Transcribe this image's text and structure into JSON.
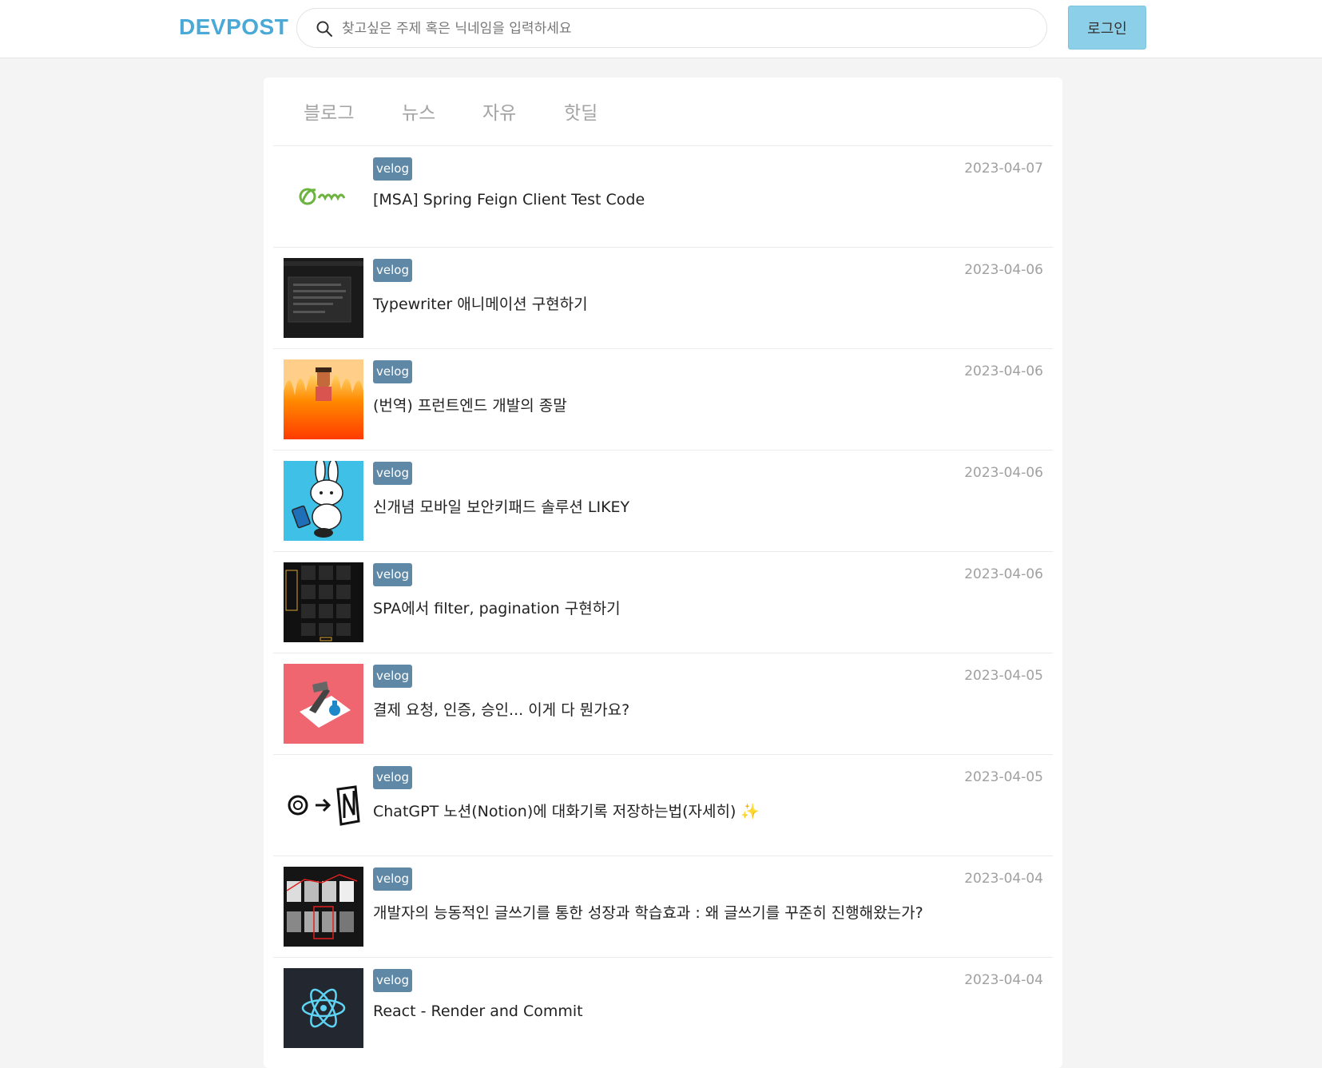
{
  "header": {
    "logo": "DEVPOST",
    "search_placeholder": "찾고싶은 주제 혹은 닉네임을 입력하세요",
    "login_label": "로그인"
  },
  "tabs": [
    {
      "label": "블로그"
    },
    {
      "label": "뉴스"
    },
    {
      "label": "자유"
    },
    {
      "label": "핫딜"
    }
  ],
  "posts": [
    {
      "source": "velog",
      "title": "[MSA] Spring Feign Client Test Code",
      "date": "2023-04-07",
      "thumb": "spring-logo"
    },
    {
      "source": "velog",
      "title": "Typewriter 애니메이션 구현하기",
      "date": "2023-04-06",
      "thumb": "dark-screenshot"
    },
    {
      "source": "velog",
      "title": "(번역) 프런트엔드 개발의 종말",
      "date": "2023-04-06",
      "thumb": "fire-image"
    },
    {
      "source": "velog",
      "title": "신개념 모바일 보안키패드 솔루션 LIKEY",
      "date": "2023-04-06",
      "thumb": "rabbit-illustration"
    },
    {
      "source": "velog",
      "title": "SPA에서 filter, pagination 구현하기",
      "date": "2023-04-06",
      "thumb": "grid-screenshot"
    },
    {
      "source": "velog",
      "title": "결제 요청, 인증, 승인... 이게 다 뭔가요?",
      "date": "2023-04-05",
      "thumb": "payment-illustration"
    },
    {
      "source": "velog",
      "title": "ChatGPT 노션(Notion)에 대화기록 저장하는법(자세히) ✨",
      "date": "2023-04-05",
      "thumb": "chatgpt-notion-logo"
    },
    {
      "source": "velog",
      "title": "개발자의 능동적인 글쓰기를 통한 성장과 학습효과 : 왜 글쓰기를 꾸준히 진행해왔는가?",
      "date": "2023-04-04",
      "thumb": "chart-screenshot"
    },
    {
      "source": "velog",
      "title": "React - Render and Commit",
      "date": "2023-04-04",
      "thumb": "react-logo"
    }
  ],
  "colors": {
    "brand": "#4aa9d6",
    "login_button": "#8ccfe8",
    "badge": "#5f88a6"
  }
}
